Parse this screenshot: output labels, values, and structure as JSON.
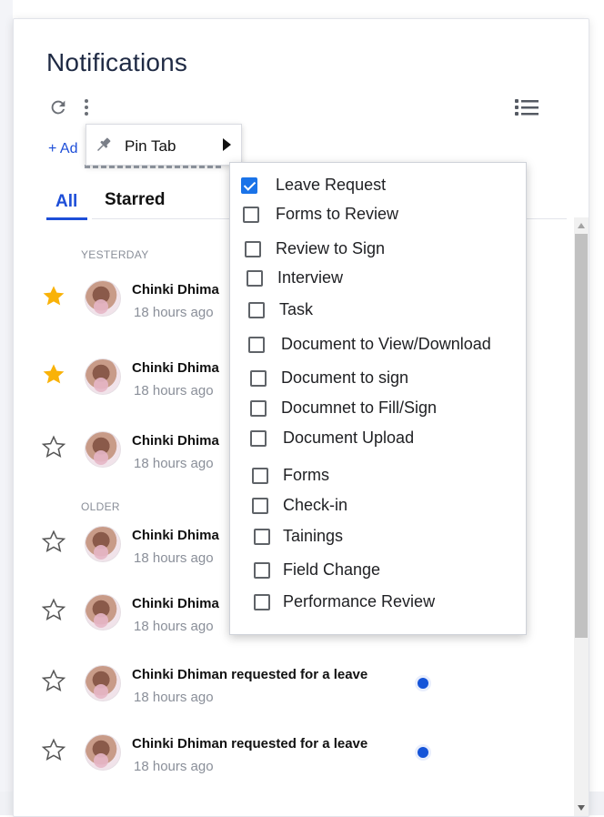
{
  "header": {
    "title": "Notifications"
  },
  "toolbar": {
    "refresh_icon": "refresh-icon",
    "more_icon": "more-vertical-icon",
    "view_icon": "list-view-icon"
  },
  "add_link": "+ Ad",
  "tabs": [
    {
      "label": "All",
      "active": true
    },
    {
      "label": "Starred",
      "active": false
    }
  ],
  "sections": {
    "yesterday": "YESTERDAY",
    "older": "OLDER"
  },
  "notifications": [
    {
      "title": "Chinki Dhima",
      "time": "18 hours ago",
      "starred": true,
      "unread": false
    },
    {
      "title": "Chinki Dhima",
      "time": "18 hours ago",
      "starred": true,
      "unread": false
    },
    {
      "title": "Chinki Dhima",
      "time": "18 hours ago",
      "starred": false,
      "unread": false
    },
    {
      "title": "Chinki Dhima",
      "time": "18 hours ago",
      "starred": false,
      "unread": false
    },
    {
      "title": "Chinki Dhima",
      "time": "18 hours ago",
      "starred": false,
      "unread": false
    },
    {
      "title": "Chinki Dhiman requested for a leave",
      "time": "18 hours ago",
      "starred": false,
      "unread": true
    },
    {
      "title": "Chinki Dhiman requested for a leave",
      "time": "18 hours ago",
      "starred": false,
      "unread": true
    }
  ],
  "pin_menu": {
    "label": "Pin Tab"
  },
  "filter_menu": {
    "items": [
      {
        "label": "Leave Request",
        "checked": true
      },
      {
        "label": "Forms to Review",
        "checked": false
      },
      {
        "label": "Review to Sign",
        "checked": false
      },
      {
        "label": "Interview",
        "checked": false
      },
      {
        "label": "Task",
        "checked": false
      },
      {
        "label": "Document to View/Download",
        "checked": false
      },
      {
        "label": "Document to sign",
        "checked": false
      },
      {
        "label": "Documnet to Fill/Sign",
        "checked": false
      },
      {
        "label": "Document Upload",
        "checked": false
      },
      {
        "label": "Forms",
        "checked": false
      },
      {
        "label": "Check-in",
        "checked": false
      },
      {
        "label": "Tainings",
        "checked": false
      },
      {
        "label": "Field Change",
        "checked": false
      },
      {
        "label": "Performance Review",
        "checked": false
      }
    ]
  },
  "colors": {
    "accent": "#1d4ed8",
    "star_filled": "#f9b208",
    "checkbox_checked": "#1a73e8",
    "unread_dot": "#1554d8"
  }
}
